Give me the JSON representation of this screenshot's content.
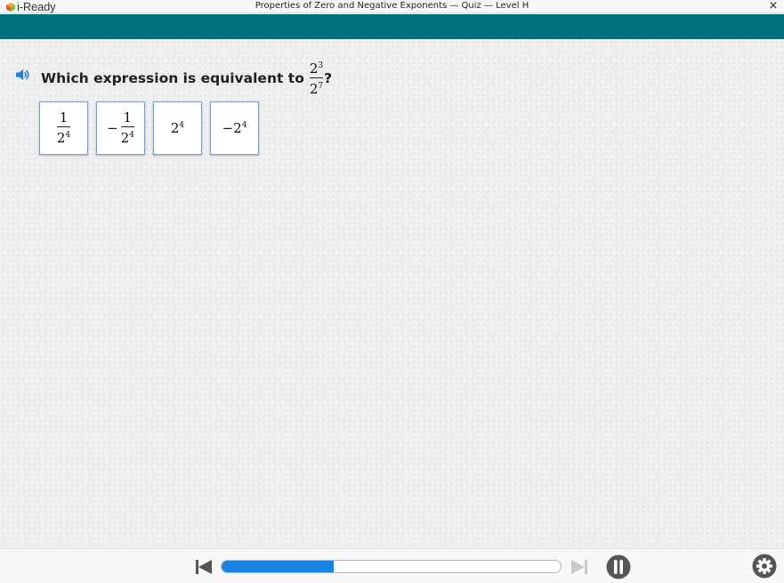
{
  "window": {
    "app_name": "i-Ready",
    "title": "Properties of Zero and Negative Exponents — Quiz — Level H",
    "close_icon": "×"
  },
  "colors": {
    "header_teal": "#03707f",
    "progress_blue": "#1a82e2",
    "choice_border": "#7d9cc4",
    "speaker_blue": "#1a82e2"
  },
  "question": {
    "text": "Which expression is equivalent to",
    "fraction": {
      "numerator_base": "2",
      "numerator_exp": "3",
      "denominator_base": "2",
      "denominator_exp": "7"
    },
    "end_mark": "?",
    "audio_icon": "speaker-icon"
  },
  "choices": [
    {
      "type": "fraction",
      "sign": "",
      "numerator": "1",
      "base": "2",
      "exp": "4"
    },
    {
      "type": "fraction",
      "sign": "−",
      "numerator": "1",
      "base": "2",
      "exp": "4"
    },
    {
      "type": "power",
      "sign": "",
      "base": "2",
      "exp": "4"
    },
    {
      "type": "power",
      "sign": "−",
      "base": "2",
      "exp": "4"
    }
  ],
  "player": {
    "progress_percent": 33,
    "back_icon": "skip-back-icon",
    "forward_icon": "skip-forward-icon",
    "pause_icon": "pause-icon",
    "settings_icon": "gear-icon"
  }
}
